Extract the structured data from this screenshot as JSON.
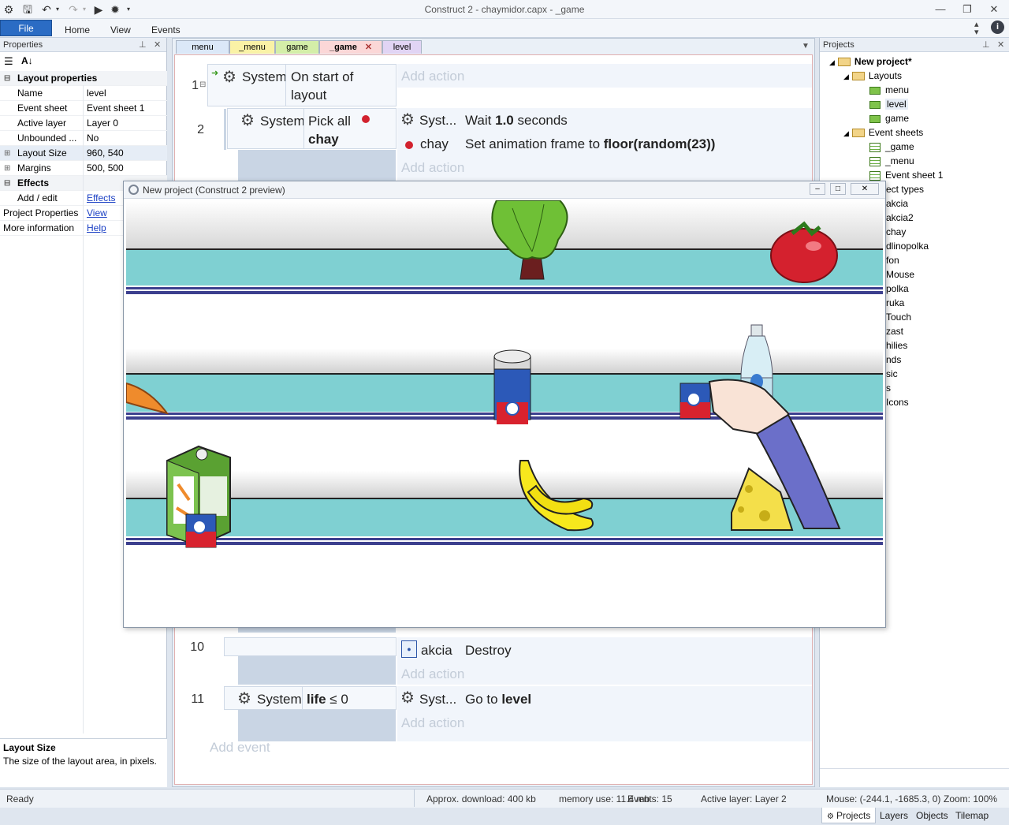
{
  "window": {
    "title": "Construct 2 - chaymidor.capx - _game"
  },
  "ribbon": {
    "file": "File",
    "tabs": [
      "Home",
      "View",
      "Events"
    ]
  },
  "properties": {
    "title": "Properties",
    "section_layout": "Layout properties",
    "rows": [
      {
        "k": "Name",
        "v": "level"
      },
      {
        "k": "Event sheet",
        "v": "Event sheet 1"
      },
      {
        "k": "Active layer",
        "v": "Layer 0"
      },
      {
        "k": "Unbounded ...",
        "v": "No"
      },
      {
        "k": "Layout Size",
        "v": "960, 540"
      },
      {
        "k": "Margins",
        "v": "500, 500"
      }
    ],
    "section_effects": "Effects",
    "effects_k": "Add / edit",
    "effects_v": "Effects",
    "projprops_k": "Project Properties",
    "projprops_v": "View",
    "moreinfo_k": "More information",
    "moreinfo_v": "Help",
    "desc_title": "Layout Size",
    "desc_text": "The size of the layout area, in pixels."
  },
  "editor": {
    "tabs": [
      "menu",
      "_menu",
      "game",
      "_game",
      "level"
    ],
    "events": {
      "e1": {
        "num": "1",
        "obj": "System",
        "cond1": "On start of",
        "cond2": "layout"
      },
      "e2": {
        "num": "2",
        "obj": "System",
        "cond1": "Pick all",
        "cond2": "chay"
      },
      "e10": {
        "num": "10",
        "act_obj": "akcia",
        "act": "Destroy"
      },
      "e11": {
        "num": "11",
        "obj": "System",
        "cond_var": "life",
        "cond_rest": "≤ 0",
        "act_obj": "Syst...",
        "act_pre": "Go to",
        "act_bold": "level"
      }
    },
    "actions": {
      "wait_obj": "Syst...",
      "wait_pre": "Wait",
      "wait_bold": "1.0",
      "wait_post": "seconds",
      "anim_obj": "chay",
      "anim_pre": "Set animation frame to",
      "anim_bold": "floor(random(23))"
    },
    "add_action": "Add action",
    "add_event": "Add event"
  },
  "projects": {
    "title": "Projects",
    "root": "New project*",
    "layouts": "Layouts",
    "layout_items": [
      "menu",
      "level",
      "game"
    ],
    "eventsheets": "Event sheets",
    "sheet_items": [
      "_game",
      "_menu",
      "Event sheet 1"
    ],
    "objects_partial": [
      "ect types",
      "akcia",
      "akcia2",
      "chay",
      "dlinopolka",
      "fon",
      "Mouse",
      "polka",
      "ruka",
      "Touch",
      "zast",
      "hilies",
      "nds",
      "sic",
      "s",
      "Icons"
    ],
    "bottom_tabs": [
      "Projects",
      "Layers",
      "Objects",
      "Tilemap"
    ]
  },
  "preview": {
    "title": "New project (Construct 2 preview)"
  },
  "status": {
    "ready": "Ready",
    "download": "Approx. download: 400 kb",
    "memory": "memory use: 11.4 mb",
    "events": "Events: 15",
    "layer": "Active layer: Layer 2",
    "mouse": "Mouse: (-244.1, -1685.3, 0)",
    "zoom": "Zoom: 100%"
  },
  "colors": {
    "accent": "#2b6cc4",
    "shelf": "#7fd1d3",
    "shelf_stripe": "#3c3f8e"
  }
}
